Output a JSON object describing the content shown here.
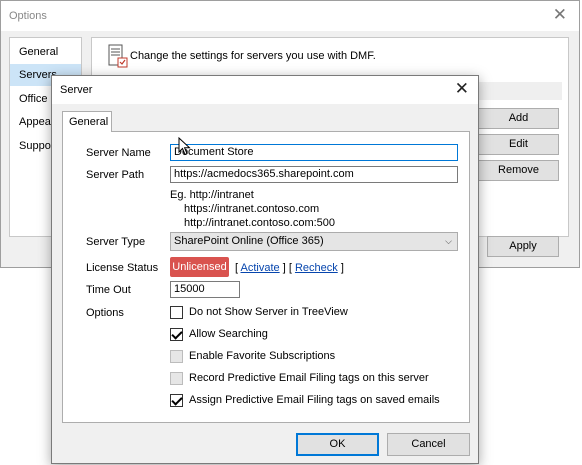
{
  "options_window": {
    "title": "Options",
    "close_glyph": "✕",
    "sidebar": [
      "General",
      "Servers",
      "Office",
      "Appear",
      "Suppor"
    ],
    "description": "Change the settings for servers you use with DMF.",
    "buttons": {
      "add": "Add",
      "edit": "Edit",
      "remove": "Remove",
      "apply": "Apply"
    }
  },
  "dialog": {
    "title": "Server",
    "close_glyph": "✕",
    "tab": "General",
    "server_name_label": "Server Name",
    "server_name_value": "Document Store",
    "server_path_label": "Server Path",
    "server_path_value": "https://acmedocs365.sharepoint.com",
    "examples": [
      "Eg.  http://intranet",
      "https://intranet.contoso.com",
      "http://intranet.contoso.com:500"
    ],
    "server_type_label": "Server Type",
    "server_type_value": "SharePoint Online (Office 365)",
    "license_status_label": "License Status",
    "license_badge": "Unlicensed",
    "license_badge_color": "#d9534f",
    "activate_link": "Activate",
    "recheck_link": "Recheck",
    "bracket_open": "[",
    "bracket_mid": "] [",
    "bracket_close": "]",
    "timeout_label": "Time Out",
    "timeout_value": "15000",
    "options_label": "Options",
    "options": [
      {
        "label": "Do not Show Server in TreeView",
        "checked": false,
        "disabled": false
      },
      {
        "label": "Allow Searching",
        "checked": true,
        "disabled": false
      },
      {
        "label": "Enable Favorite Subscriptions",
        "checked": false,
        "disabled": true
      },
      {
        "label": "Record Predictive Email Filing tags on this server",
        "checked": false,
        "disabled": true
      },
      {
        "label": "Assign Predictive Email Filing tags on saved emails",
        "checked": true,
        "disabled": false
      }
    ],
    "ok": "OK",
    "cancel": "Cancel"
  },
  "accent_color": "#0078d7",
  "icons": [
    "server-settings-icon",
    "close-icon",
    "chevron-down-icon",
    "mouse-cursor-icon"
  ]
}
